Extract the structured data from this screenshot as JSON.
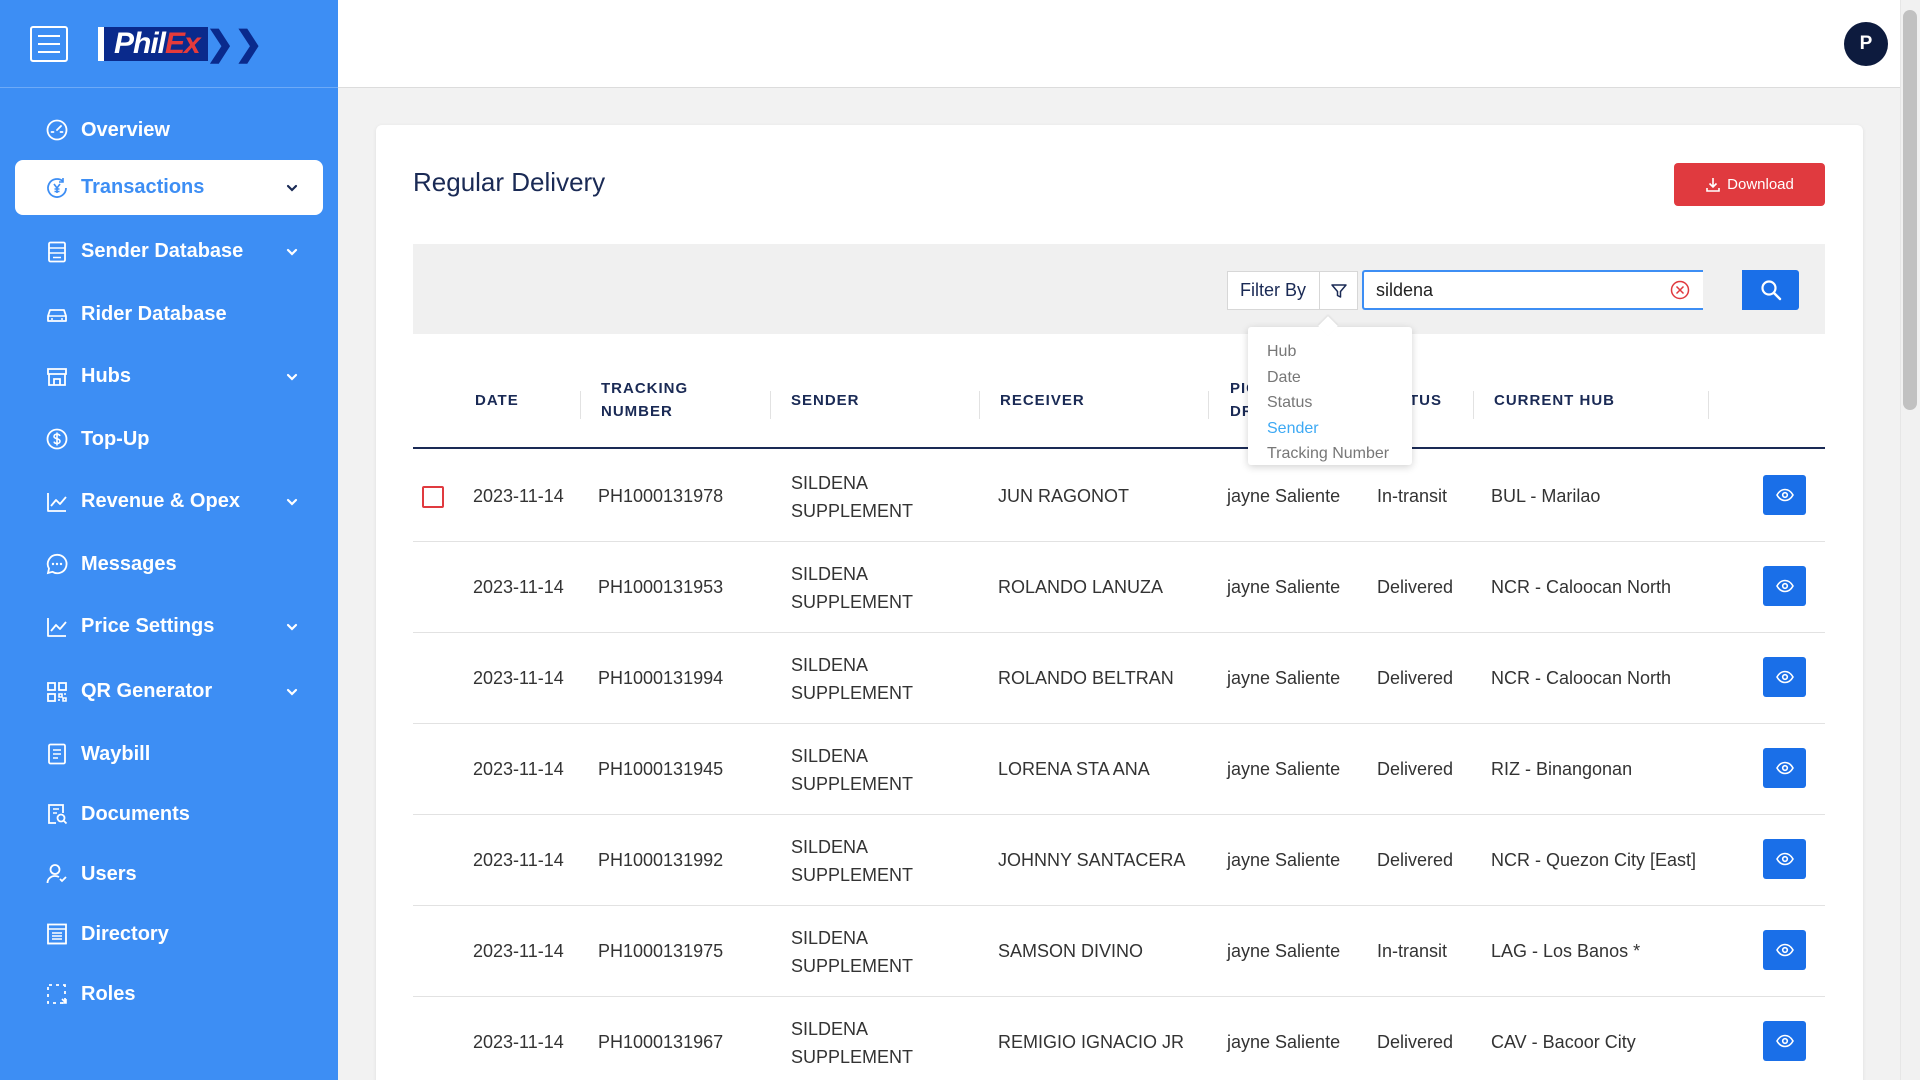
{
  "brand": {
    "logo_text_a": "Phil",
    "logo_text_b": "Ex"
  },
  "sidebar": {
    "items": [
      {
        "label": "Overview",
        "icon": "speedometer-icon",
        "chevron": false
      },
      {
        "label": "Transactions",
        "icon": "yen-circle-icon",
        "chevron": true,
        "active": true
      },
      {
        "label": "Sender Database",
        "icon": "list-icon",
        "chevron": true
      },
      {
        "label": "Rider Database",
        "icon": "car-icon",
        "chevron": false
      },
      {
        "label": "Hubs",
        "icon": "store-icon",
        "chevron": true
      },
      {
        "label": "Top-Up",
        "icon": "dollar-circle-icon",
        "chevron": false
      },
      {
        "label": "Revenue & Opex",
        "icon": "line-chart-icon",
        "chevron": true
      },
      {
        "label": "Messages",
        "icon": "chat-icon",
        "chevron": false
      },
      {
        "label": "Price Settings",
        "icon": "line-chart-icon",
        "chevron": true
      },
      {
        "label": "QR Generator",
        "icon": "qr-icon",
        "chevron": true
      },
      {
        "label": "Waybill",
        "icon": "document-icon",
        "chevron": false
      },
      {
        "label": "Documents",
        "icon": "document-search-icon",
        "chevron": false
      },
      {
        "label": "Users",
        "icon": "users-icon",
        "chevron": false
      },
      {
        "label": "Directory",
        "icon": "directory-icon",
        "chevron": false
      },
      {
        "label": "Roles",
        "icon": "roles-icon",
        "chevron": false
      }
    ]
  },
  "topbar": {
    "avatar_initial": "P"
  },
  "page": {
    "title": "Regular Delivery",
    "download_label": "Download"
  },
  "filter": {
    "label": "Filter By",
    "search_value": "sildena",
    "options": [
      "Hub",
      "Date",
      "Status",
      "Sender",
      "Tracking Number"
    ],
    "selected": "Sender"
  },
  "table": {
    "headers": {
      "date": "DATE",
      "tracking_1": "TRACKING",
      "tracking_2": "NUMBER",
      "sender": "SENDER",
      "receiver": "RECEIVER",
      "pickup_1": "PIC",
      "pickup_2": "DR",
      "status": "TUS",
      "hub": "CURRENT HUB"
    },
    "rows": [
      {
        "date": "2023-11-14",
        "tracking": "PH1000131978",
        "sender_1": "SILDENA",
        "sender_2": "SUPPLEMENT",
        "receiver": "JUN RAGONOT",
        "driver": "jayne Saliente",
        "status": "In-transit",
        "hub": "BUL - Marilao"
      },
      {
        "date": "2023-11-14",
        "tracking": "PH1000131953",
        "sender_1": "SILDENA",
        "sender_2": "SUPPLEMENT",
        "receiver": "ROLANDO LANUZA",
        "driver": "jayne Saliente",
        "status": "Delivered",
        "hub": "NCR - Caloocan North"
      },
      {
        "date": "2023-11-14",
        "tracking": "PH1000131994",
        "sender_1": "SILDENA",
        "sender_2": "SUPPLEMENT",
        "receiver": "ROLANDO BELTRAN",
        "driver": "jayne Saliente",
        "status": "Delivered",
        "hub": "NCR - Caloocan North"
      },
      {
        "date": "2023-11-14",
        "tracking": "PH1000131945",
        "sender_1": "SILDENA",
        "sender_2": "SUPPLEMENT",
        "receiver": "LORENA STA ANA",
        "driver": "jayne Saliente",
        "status": "Delivered",
        "hub": "RIZ - Binangonan"
      },
      {
        "date": "2023-11-14",
        "tracking": "PH1000131992",
        "sender_1": "SILDENA",
        "sender_2": "SUPPLEMENT",
        "receiver": "JOHNNY SANTACERA",
        "driver": "jayne Saliente",
        "status": "Delivered",
        "hub": "NCR - Quezon City [East]"
      },
      {
        "date": "2023-11-14",
        "tracking": "PH1000131975",
        "sender_1": "SILDENA",
        "sender_2": "SUPPLEMENT",
        "receiver": "SAMSON DIVINO",
        "driver": "jayne Saliente",
        "status": "In-transit",
        "hub": "LAG - Los Banos *"
      },
      {
        "date": "2023-11-14",
        "tracking": "PH1000131967",
        "sender_1": "SILDENA",
        "sender_2": "SUPPLEMENT",
        "receiver": "REMIGIO IGNACIO JR",
        "driver": "jayne Saliente",
        "status": "Delivered",
        "hub": "CAV - Bacoor City"
      }
    ]
  },
  "colors": {
    "sidebar": "#3d8ef4",
    "primary": "#1a6fe8",
    "danger": "#e03a3f",
    "heading": "#1a2a55"
  }
}
